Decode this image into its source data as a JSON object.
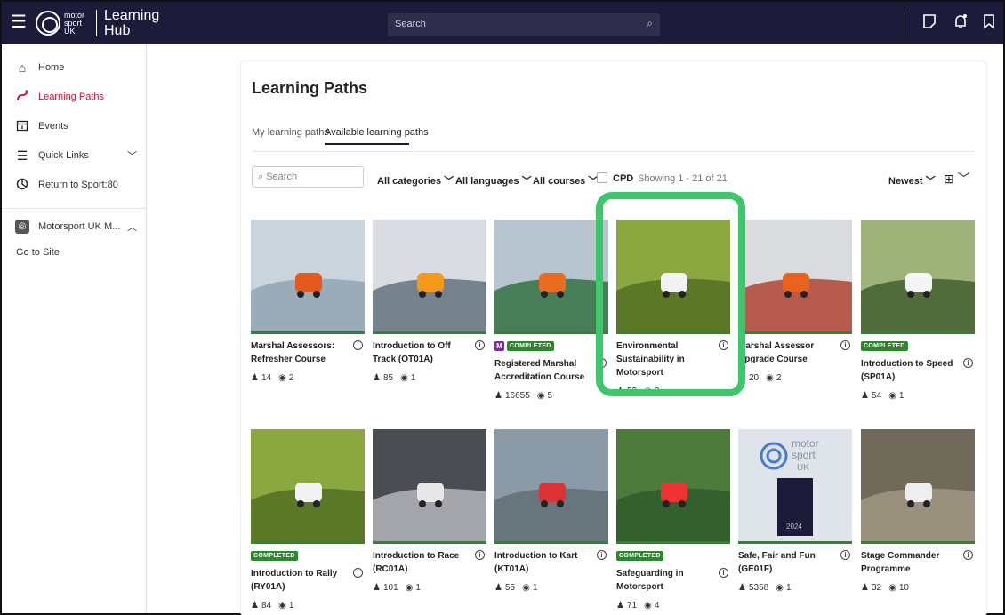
{
  "header": {
    "logo_line1": "motor",
    "logo_line2": "sport",
    "logo_line3": "UK",
    "hub_line1": "Learning",
    "hub_line2": "Hub",
    "search_placeholder": "Search"
  },
  "sidebar": {
    "items": [
      {
        "label": "Home",
        "icon": "home-icon"
      },
      {
        "label": "Learning Paths",
        "icon": "path-icon"
      },
      {
        "label": "Events",
        "icon": "calendar-icon"
      },
      {
        "label": "Quick Links",
        "icon": "list-icon"
      },
      {
        "label": "Return to Sport:80",
        "icon": "clock-icon"
      },
      {
        "label": "Motorsport UK M...",
        "icon": "mo-icon"
      }
    ],
    "goto": "Go to Site"
  },
  "main": {
    "title": "Learning Paths",
    "tabs": [
      "My learning paths",
      "Available learning paths"
    ],
    "search_placeholder": "Search",
    "filters": [
      "All categories",
      "All languages",
      "All courses"
    ],
    "cpd": "CPD",
    "showing": "Showing 1 - 21 of 21",
    "sort": "Newest"
  },
  "courses": [
    {
      "title": "Marshal Assessors: Refresher Course",
      "learners": "14",
      "courses": "2",
      "completed": false,
      "m": false
    },
    {
      "title": "Introduction to Off Track (OT01A)",
      "learners": "85",
      "courses": "1",
      "completed": false,
      "m": false
    },
    {
      "title": "Registered Marshal Accreditation Course",
      "learners": "16655",
      "courses": "5",
      "completed": true,
      "m": true
    },
    {
      "title": "Environmental Sustainability in Motorsport",
      "learners": "52",
      "courses": "3",
      "completed": false,
      "m": false
    },
    {
      "title": "Marshal Assessor Upgrade Course",
      "learners": "20",
      "courses": "2",
      "completed": false,
      "m": false
    },
    {
      "title": "Introduction to Speed (SP01A)",
      "learners": "54",
      "courses": "1",
      "completed": true,
      "m": false
    },
    {
      "title": "Introduction to Rally (RY01A)",
      "learners": "84",
      "courses": "1",
      "completed": true,
      "m": false
    },
    {
      "title": "Introduction to Race (RC01A)",
      "learners": "101",
      "courses": "1",
      "completed": false,
      "m": false
    },
    {
      "title": "Introduction to Kart (KT01A)",
      "learners": "55",
      "courses": "1",
      "completed": false,
      "m": false
    },
    {
      "title": "Safeguarding in Motorsport",
      "learners": "71",
      "courses": "4",
      "completed": true,
      "m": false
    },
    {
      "title": "Safe, Fair and Fun (GE01F)",
      "learners": "5358",
      "courses": "1",
      "completed": false,
      "m": false
    },
    {
      "title": "Stage Commander Programme",
      "learners": "32",
      "courses": "10",
      "completed": false,
      "m": false
    }
  ],
  "labels": {
    "completed": "COMPLETED",
    "m": "M",
    "info": "i"
  },
  "thumb_text": {
    "logo_line1": "motor",
    "logo_line2": "sport",
    "logo_line3": "UK",
    "year": "2024"
  },
  "colors": {
    "topbar": "#1c1b3a",
    "accent_red": "#c8102e",
    "completed_green": "#2a8a2a",
    "highlight": "#3cc86a"
  }
}
